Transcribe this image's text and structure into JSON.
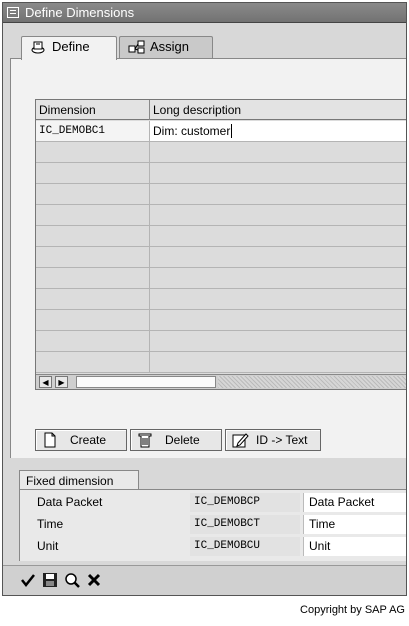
{
  "window": {
    "title": "Define Dimensions"
  },
  "tabs": [
    {
      "label": "Define",
      "icon": "define-icon"
    },
    {
      "label": "Assign",
      "icon": "assign-icon"
    }
  ],
  "grid": {
    "columns": [
      "Dimension",
      "Long description"
    ],
    "rows": [
      {
        "dimension": "IC_DEMOBC1",
        "long_description": "Dim: customer"
      }
    ]
  },
  "buttons": {
    "create": "Create",
    "delete": "Delete",
    "id_to_text": "ID -> Text"
  },
  "fixed_dimension": {
    "title": "Fixed dimension",
    "rows": [
      {
        "label": "Data Packet",
        "value": "IC_DEMOBCP",
        "description": "Data Packet"
      },
      {
        "label": "Time",
        "value": "IC_DEMOBCT",
        "description": "Time"
      },
      {
        "label": "Unit",
        "value": "IC_DEMOBCU",
        "description": "Unit"
      }
    ]
  },
  "toolbar_icons": [
    "check-icon",
    "save-icon",
    "find-icon",
    "cancel-icon"
  ],
  "copyright": "Copyright by SAP AG"
}
